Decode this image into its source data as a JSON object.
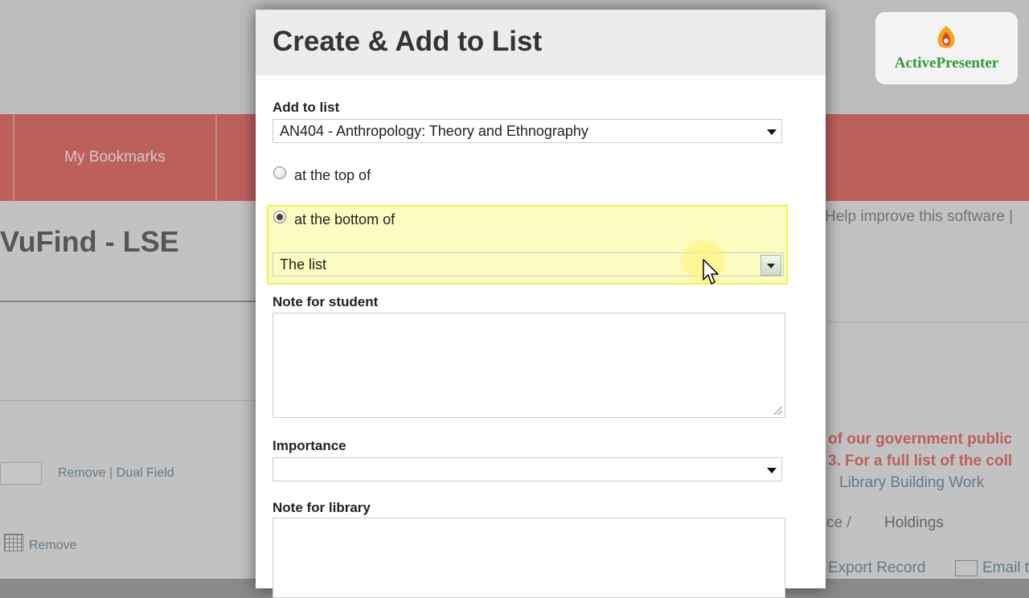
{
  "background": {
    "nav_bookmarks": "My Bookmarks",
    "site_title": "VuFind - LSE",
    "left_links": {
      "remove": "Remove",
      "separator": "|",
      "dual_field": "Dual Field",
      "remove2": "Remove"
    },
    "right_help": "Help improve this software |",
    "right_notice_line1": "of our government public",
    "right_notice_line2": "3. For a full list of the coll",
    "right_link": "Library Building Work",
    "right_breadcrumb": "ce /",
    "right_holdings": "Holdings",
    "right_export": "Export Record",
    "right_email": "Email t",
    "colors": {
      "nav_bar": "#e8766e",
      "notice_text": "#e8766e",
      "link": "#7b95a8"
    }
  },
  "watermark": {
    "text": "ActivePresenter",
    "icon": "activepresenter-logo-icon",
    "color": "#2e9a3a"
  },
  "dialog": {
    "title": "Create & Add to List",
    "add_to_list": {
      "label": "Add to list",
      "selected": "AN404 - Anthropology: Theory and Ethnography"
    },
    "position": {
      "option_top": "at the top of",
      "option_bottom": "at the bottom of",
      "selected": "at the bottom of",
      "target_selected": "The list"
    },
    "note_for_student": {
      "label": "Note for student",
      "value": ""
    },
    "importance": {
      "label": "Importance",
      "selected": ""
    },
    "note_for_library": {
      "label": "Note for library",
      "value": ""
    }
  }
}
